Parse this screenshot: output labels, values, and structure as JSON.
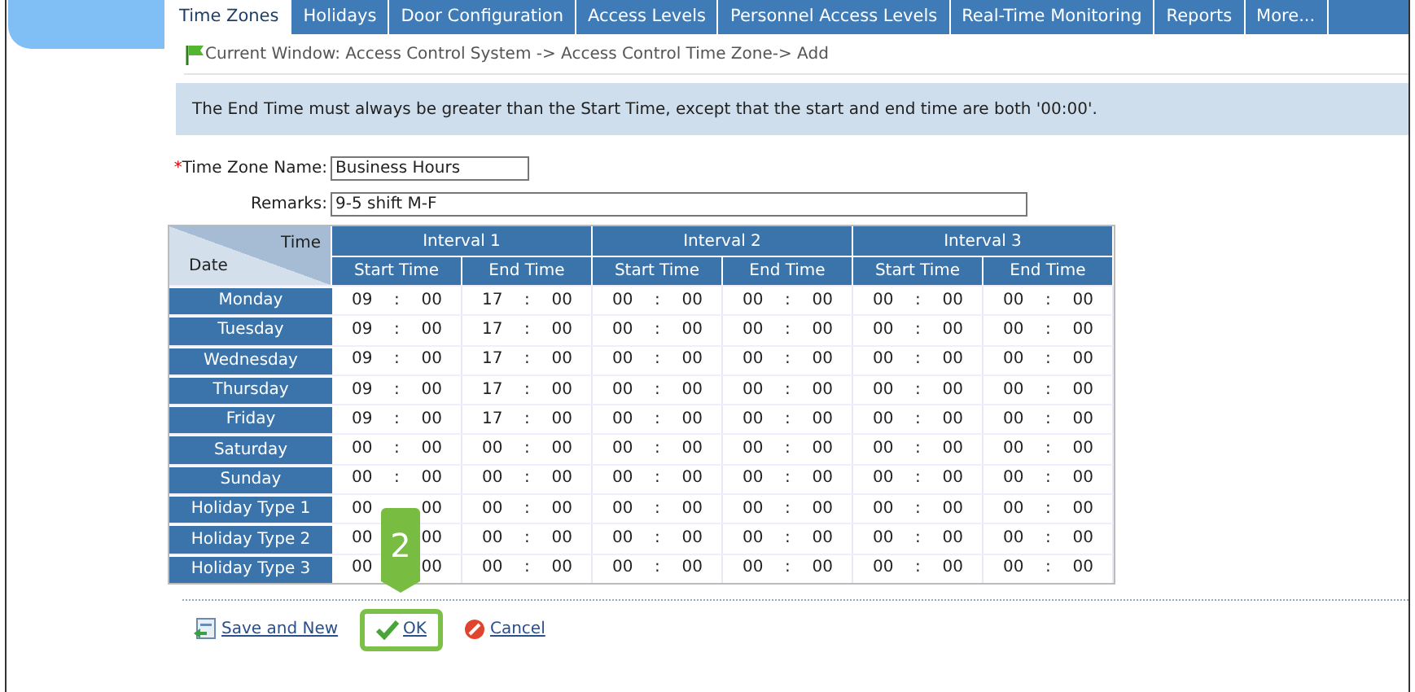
{
  "tabs": [
    {
      "label": "Time Zones",
      "selected": true
    },
    {
      "label": "Holidays",
      "selected": false
    },
    {
      "label": "Door Configuration",
      "selected": false
    },
    {
      "label": "Access Levels",
      "selected": false
    },
    {
      "label": "Personnel Access Levels",
      "selected": false
    },
    {
      "label": "Real-Time Monitoring",
      "selected": false
    },
    {
      "label": "Reports",
      "selected": false
    },
    {
      "label": "More...",
      "selected": false
    }
  ],
  "breadcrumb": "Current Window: Access Control System -> Access Control Time Zone-> Add",
  "notice": "The End Time must always be greater than the Start Time, except that the start and end time are both '00:00'.",
  "form": {
    "name_label": "Time Zone Name:",
    "required_mark": "*",
    "name_value": "Business Hours",
    "remarks_label": "Remarks:",
    "remarks_value": "9-5 shift M-F"
  },
  "table": {
    "corner_top": "Time",
    "corner_bottom": "Date",
    "intervals": [
      "Interval 1",
      "Interval 2",
      "Interval 3"
    ],
    "subheads": [
      "Start Time",
      "End Time",
      "Start Time",
      "End Time",
      "Start Time",
      "End Time"
    ],
    "rows": [
      {
        "day": "Monday",
        "times": [
          {
            "h": "09",
            "sep": ":",
            "m": "00"
          },
          {
            "h": "17",
            "sep": ":",
            "m": "00"
          },
          {
            "h": "00",
            "sep": ":",
            "m": "00"
          },
          {
            "h": "00",
            "sep": ":",
            "m": "00"
          },
          {
            "h": "00",
            "sep": ":",
            "m": "00"
          },
          {
            "h": "00",
            "sep": ":",
            "m": "00"
          }
        ]
      },
      {
        "day": "Tuesday",
        "times": [
          {
            "h": "09",
            "sep": ":",
            "m": "00"
          },
          {
            "h": "17",
            "sep": ":",
            "m": "00"
          },
          {
            "h": "00",
            "sep": ":",
            "m": "00"
          },
          {
            "h": "00",
            "sep": ":",
            "m": "00"
          },
          {
            "h": "00",
            "sep": ":",
            "m": "00"
          },
          {
            "h": "00",
            "sep": ":",
            "m": "00"
          }
        ]
      },
      {
        "day": "Wednesday",
        "times": [
          {
            "h": "09",
            "sep": ":",
            "m": "00"
          },
          {
            "h": "17",
            "sep": ":",
            "m": "00"
          },
          {
            "h": "00",
            "sep": ":",
            "m": "00"
          },
          {
            "h": "00",
            "sep": ":",
            "m": "00"
          },
          {
            "h": "00",
            "sep": ":",
            "m": "00"
          },
          {
            "h": "00",
            "sep": ":",
            "m": "00"
          }
        ]
      },
      {
        "day": "Thursday",
        "times": [
          {
            "h": "09",
            "sep": ":",
            "m": "00"
          },
          {
            "h": "17",
            "sep": ":",
            "m": "00"
          },
          {
            "h": "00",
            "sep": ":",
            "m": "00"
          },
          {
            "h": "00",
            "sep": ":",
            "m": "00"
          },
          {
            "h": "00",
            "sep": ":",
            "m": "00"
          },
          {
            "h": "00",
            "sep": ":",
            "m": "00"
          }
        ]
      },
      {
        "day": "Friday",
        "times": [
          {
            "h": "09",
            "sep": ":",
            "m": "00"
          },
          {
            "h": "17",
            "sep": ":",
            "m": "00"
          },
          {
            "h": "00",
            "sep": ":",
            "m": "00"
          },
          {
            "h": "00",
            "sep": ":",
            "m": "00"
          },
          {
            "h": "00",
            "sep": ":",
            "m": "00"
          },
          {
            "h": "00",
            "sep": ":",
            "m": "00"
          }
        ]
      },
      {
        "day": "Saturday",
        "times": [
          {
            "h": "00",
            "sep": ":",
            "m": "00"
          },
          {
            "h": "00",
            "sep": ":",
            "m": "00"
          },
          {
            "h": "00",
            "sep": ":",
            "m": "00"
          },
          {
            "h": "00",
            "sep": ":",
            "m": "00"
          },
          {
            "h": "00",
            "sep": ":",
            "m": "00"
          },
          {
            "h": "00",
            "sep": ":",
            "m": "00"
          }
        ]
      },
      {
        "day": "Sunday",
        "times": [
          {
            "h": "00",
            "sep": ":",
            "m": "00"
          },
          {
            "h": "00",
            "sep": ":",
            "m": "00"
          },
          {
            "h": "00",
            "sep": ":",
            "m": "00"
          },
          {
            "h": "00",
            "sep": ":",
            "m": "00"
          },
          {
            "h": "00",
            "sep": ":",
            "m": "00"
          },
          {
            "h": "00",
            "sep": ":",
            "m": "00"
          }
        ]
      },
      {
        "day": "Holiday Type 1",
        "times": [
          {
            "h": "00",
            "m": "00"
          },
          {
            "h": "00",
            "sep": ":",
            "m": "00"
          },
          {
            "h": "00",
            "sep": ":",
            "m": "00"
          },
          {
            "h": "00",
            "sep": ":",
            "m": "00"
          },
          {
            "h": "00",
            "sep": ":",
            "m": "00"
          },
          {
            "h": "00",
            "sep": ":",
            "m": "00"
          }
        ]
      },
      {
        "day": "Holiday Type 2",
        "times": [
          {
            "h": "00",
            "m": "00"
          },
          {
            "h": "00",
            "sep": ":",
            "m": "00"
          },
          {
            "h": "00",
            "sep": ":",
            "m": "00"
          },
          {
            "h": "00",
            "sep": ":",
            "m": "00"
          },
          {
            "h": "00",
            "sep": ":",
            "m": "00"
          },
          {
            "h": "00",
            "sep": ":",
            "m": "00"
          }
        ]
      },
      {
        "day": "Holiday Type 3",
        "times": [
          {
            "h": "00",
            "m": "00"
          },
          {
            "h": "00",
            "sep": ":",
            "m": "00"
          },
          {
            "h": "00",
            "sep": ":",
            "m": "00"
          },
          {
            "h": "00",
            "sep": ":",
            "m": "00"
          },
          {
            "h": "00",
            "sep": ":",
            "m": "00"
          },
          {
            "h": "00",
            "sep": ":",
            "m": "00"
          }
        ]
      }
    ]
  },
  "callout": "2",
  "actions": [
    {
      "kind": "save_new",
      "label": "Save and New",
      "highlighted": false
    },
    {
      "kind": "ok",
      "label": "OK",
      "highlighted": true
    },
    {
      "kind": "cancel",
      "label": "Cancel",
      "highlighted": false
    }
  ]
}
